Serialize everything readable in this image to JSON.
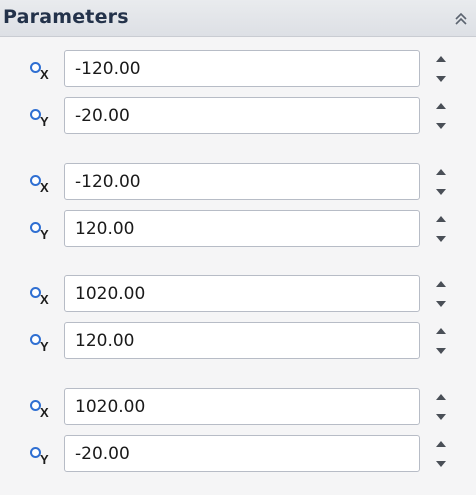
{
  "panel": {
    "title": "Parameters",
    "collapse_icon": "double-chevron-up-icon"
  },
  "points": [
    {
      "x": {
        "axis": "X",
        "value": "-120.00"
      },
      "y": {
        "axis": "Y",
        "value": "-20.00"
      }
    },
    {
      "x": {
        "axis": "X",
        "value": "-120.00"
      },
      "y": {
        "axis": "Y",
        "value": "120.00"
      }
    },
    {
      "x": {
        "axis": "X",
        "value": "1020.00"
      },
      "y": {
        "axis": "Y",
        "value": "120.00"
      }
    },
    {
      "x": {
        "axis": "X",
        "value": "1020.00"
      },
      "y": {
        "axis": "Y",
        "value": "-20.00"
      }
    }
  ],
  "icons": {
    "axis_point": "point-icon",
    "spin_up": "spin-up-icon",
    "spin_down": "spin-down-icon"
  },
  "colors": {
    "header_text": "#23324a",
    "point_icon": "#2f6fd2"
  }
}
